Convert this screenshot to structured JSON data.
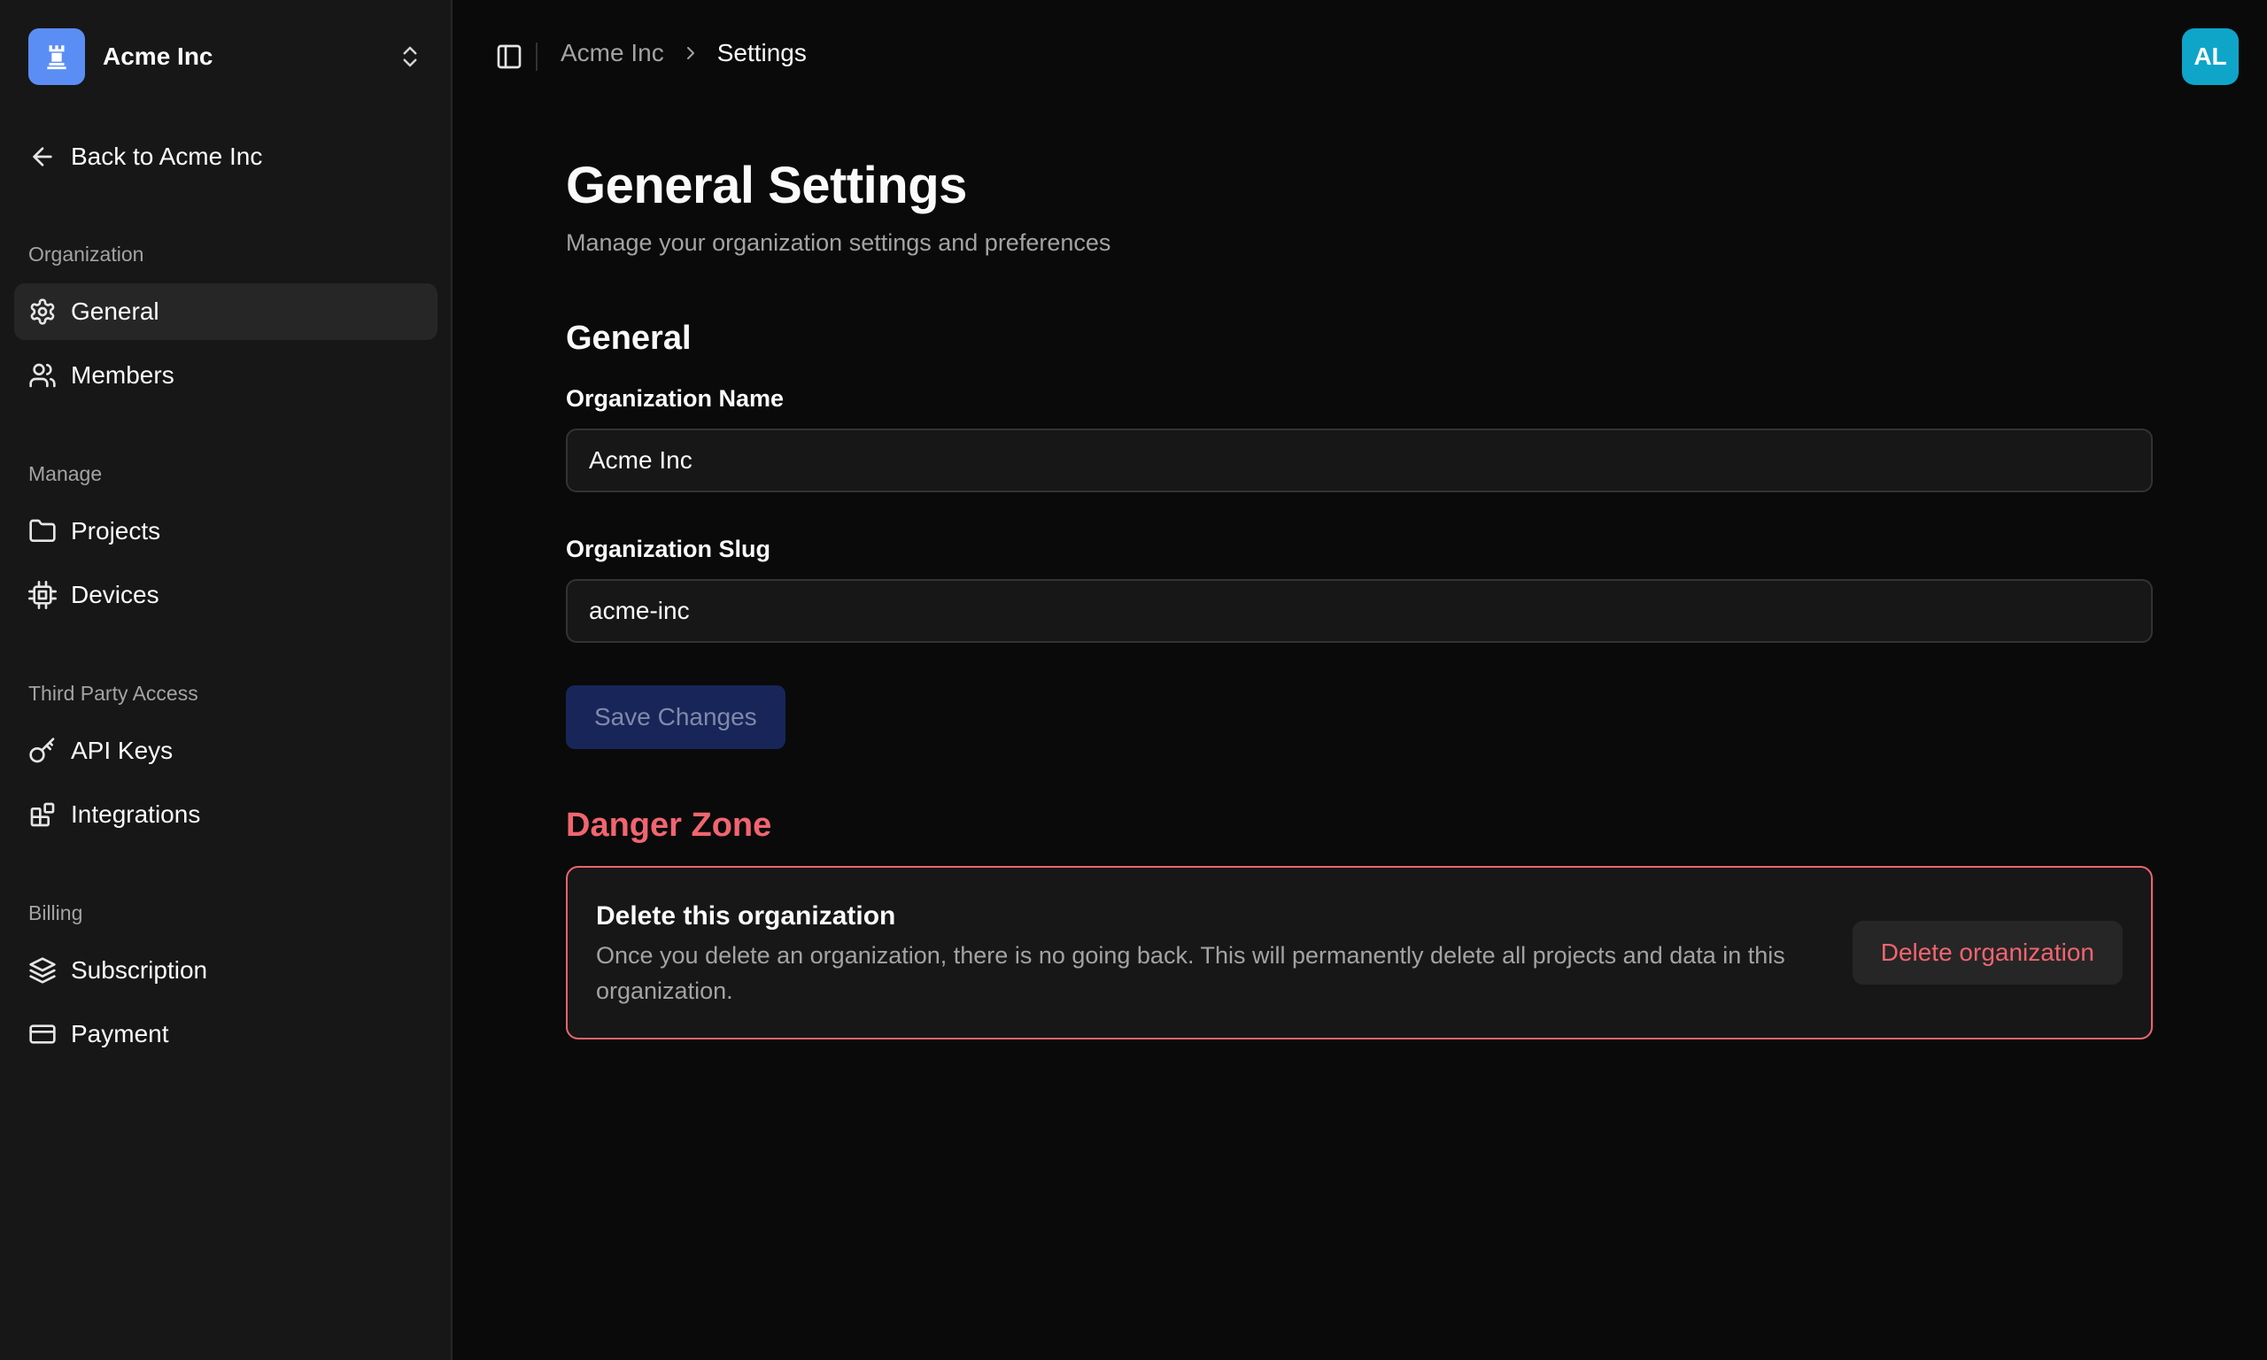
{
  "org_switcher": {
    "name": "Acme Inc",
    "logo_icon": "chess-rook-icon",
    "logo_color": "#5b8ef5",
    "toggle_icon": "chevrons-up-down-icon"
  },
  "back_link": {
    "label": "Back to Acme Inc",
    "icon": "arrow-left-icon"
  },
  "sidebar": {
    "groups": [
      {
        "label": "Organization",
        "items": [
          {
            "label": "General",
            "icon": "gear-icon",
            "active": true
          },
          {
            "label": "Members",
            "icon": "users-icon",
            "active": false
          }
        ]
      },
      {
        "label": "Manage",
        "items": [
          {
            "label": "Projects",
            "icon": "folder-icon",
            "active": false
          },
          {
            "label": "Devices",
            "icon": "cpu-chip-icon",
            "active": false
          }
        ]
      },
      {
        "label": "Third Party Access",
        "items": [
          {
            "label": "API Keys",
            "icon": "key-icon",
            "active": false
          },
          {
            "label": "Integrations",
            "icon": "blocks-icon",
            "active": false
          }
        ]
      },
      {
        "label": "Billing",
        "items": [
          {
            "label": "Subscription",
            "icon": "layers-icon",
            "active": false
          },
          {
            "label": "Payment",
            "icon": "credit-card-icon",
            "active": false
          }
        ]
      }
    ]
  },
  "header": {
    "breadcrumb": [
      "Acme Inc",
      "Settings"
    ],
    "avatar_initials": "AL",
    "avatar_color": "#0ea5c9"
  },
  "page": {
    "title": "General Settings",
    "subtitle": "Manage your organization settings and preferences"
  },
  "general": {
    "section_title": "General",
    "org_name_label": "Organization Name",
    "org_name_value": "Acme Inc",
    "org_slug_label": "Organization Slug",
    "org_slug_value": "acme-inc",
    "save_label": "Save Changes"
  },
  "danger": {
    "section_title": "Danger Zone",
    "card_title": "Delete this organization",
    "card_description": "Once you delete an organization, there is no going back. This will permanently delete all projects and data in this organization.",
    "button_label": "Delete organization",
    "accent_color": "#f06570"
  }
}
